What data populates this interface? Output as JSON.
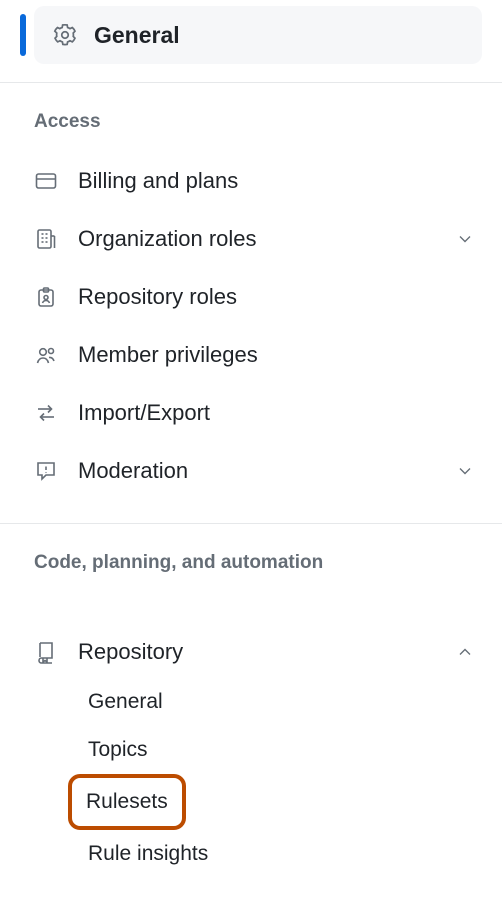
{
  "selected": {
    "label": "General"
  },
  "sections": {
    "access": {
      "header": "Access",
      "items": {
        "billing": {
          "label": "Billing and plans"
        },
        "orgroles": {
          "label": "Organization roles"
        },
        "reporoles": {
          "label": "Repository roles"
        },
        "member": {
          "label": "Member privileges"
        },
        "importexport": {
          "label": "Import/Export"
        },
        "moderation": {
          "label": "Moderation"
        }
      }
    },
    "code": {
      "header": "Code, planning, and automation",
      "repository": {
        "label": "Repository",
        "children": {
          "general": {
            "label": "General"
          },
          "topics": {
            "label": "Topics"
          },
          "rulesets": {
            "label": "Rulesets"
          },
          "ruleinsights": {
            "label": "Rule insights"
          }
        }
      }
    }
  }
}
